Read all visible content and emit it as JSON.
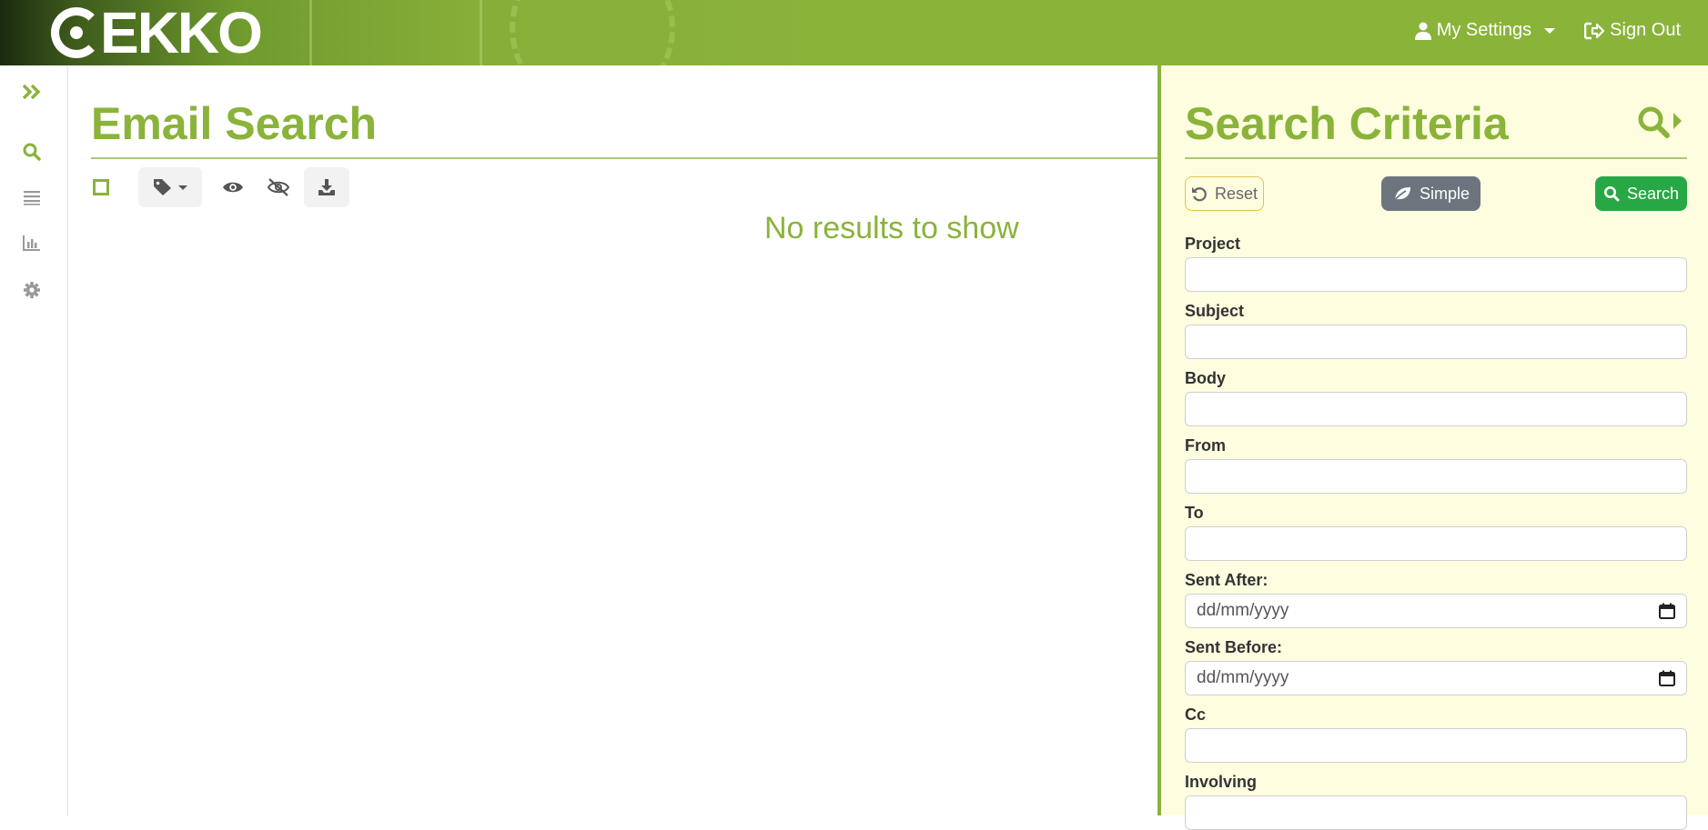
{
  "header": {
    "logo_text": "EKKO",
    "settings_label": "My Settings",
    "signout_label": "Sign Out",
    "bg_color": "#8ab33a"
  },
  "rail": {
    "items": [
      {
        "icon": "expand-icon"
      },
      {
        "icon": "search-icon"
      },
      {
        "icon": "list-icon"
      },
      {
        "icon": "chart-icon"
      },
      {
        "icon": "gear-icon"
      }
    ]
  },
  "main": {
    "title": "Email Search",
    "empty_message": "No results to show",
    "toolbar": {
      "icons": [
        "select-all-checkbox",
        "tag-icon",
        "eye-icon",
        "eye-slash-icon",
        "download-icon"
      ]
    }
  },
  "panel": {
    "title": "Search Criteria",
    "reset_label": "Reset",
    "simple_label": "Simple",
    "search_label": "Search",
    "fields": {
      "project": {
        "label": "Project",
        "value": ""
      },
      "subject": {
        "label": "Subject",
        "value": ""
      },
      "body": {
        "label": "Body",
        "value": ""
      },
      "from": {
        "label": "From",
        "value": ""
      },
      "to": {
        "label": "To",
        "value": ""
      },
      "sent_after": {
        "label": "Sent After:",
        "placeholder": "dd/mm/yyyy"
      },
      "sent_before": {
        "label": "Sent Before:",
        "placeholder": "dd/mm/yyyy"
      },
      "cc": {
        "label": "Cc",
        "value": ""
      },
      "involving": {
        "label": "Involving",
        "value": ""
      }
    }
  },
  "colors": {
    "accent": "#8ab33a",
    "panel_bg": "#fffde0",
    "search_button": "#28a745",
    "simple_button": "#6c757d"
  }
}
